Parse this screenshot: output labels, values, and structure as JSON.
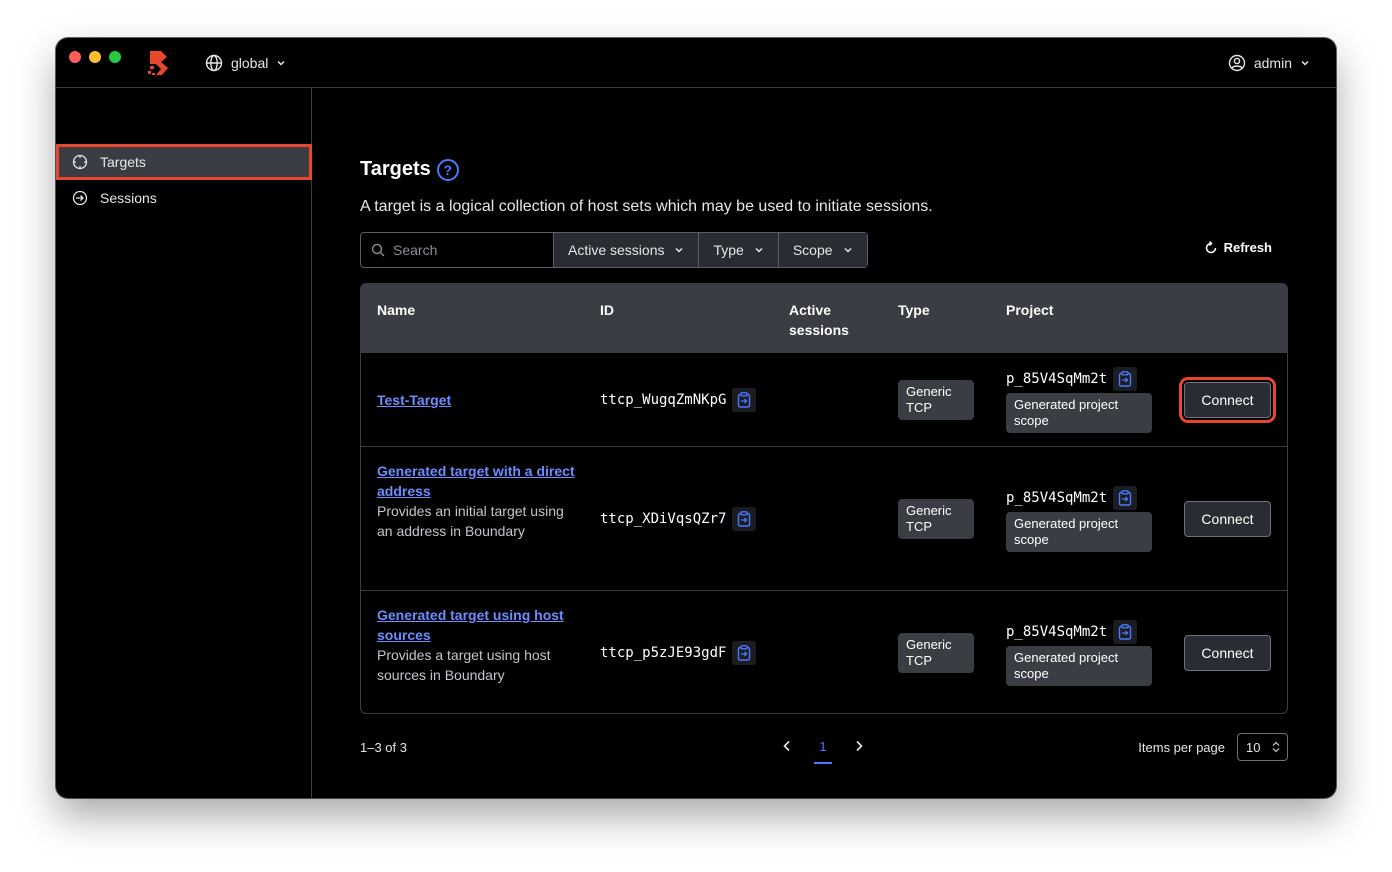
{
  "header": {
    "scope_label": "global",
    "user_label": "admin"
  },
  "sidebar": {
    "items": [
      {
        "label": "Targets",
        "icon": "crosshair-icon",
        "active": true
      },
      {
        "label": "Sessions",
        "icon": "session-arrow-icon",
        "active": false
      }
    ]
  },
  "page": {
    "title": "Targets",
    "help_icon_text": "?",
    "description": "A target is a logical collection of host sets which may be used to initiate sessions."
  },
  "filters": {
    "search_placeholder": "Search",
    "active_sessions_label": "Active sessions",
    "type_label": "Type",
    "scope_label": "Scope",
    "refresh_label": "Refresh"
  },
  "table": {
    "columns": {
      "name": "Name",
      "id": "ID",
      "active_sessions": "Active sessions",
      "type": "Type",
      "project": "Project"
    },
    "rows": [
      {
        "name": "Test-Target",
        "description": "",
        "id": "ttcp_WugqZmNKpG",
        "active_sessions": "",
        "type": "Generic TCP",
        "project_id": "p_85V4SqMm2t",
        "project_scope": "Generated project scope",
        "action": "Connect"
      },
      {
        "name": "Generated target with a direct address",
        "description": "Provides an initial target using an address in Boundary",
        "id": "ttcp_XDiVqsQZr7",
        "active_sessions": "",
        "type": "Generic TCP",
        "project_id": "p_85V4SqMm2t",
        "project_scope": "Generated project scope",
        "action": "Connect"
      },
      {
        "name": "Generated target using host sources",
        "description": "Provides a target using host sources in Boundary",
        "id": "ttcp_p5zJE93gdF",
        "active_sessions": "",
        "type": "Generic TCP",
        "project_id": "p_85V4SqMm2t",
        "project_scope": "Generated project scope",
        "action": "Connect"
      }
    ]
  },
  "pagination": {
    "summary": "1–3 of 3",
    "current_page": "1",
    "items_per_page_label": "Items per page",
    "items_per_page_value": "10"
  },
  "colors": {
    "accent": "#4a78ff",
    "highlight": "#e8472c",
    "brand": "#e8472c"
  }
}
